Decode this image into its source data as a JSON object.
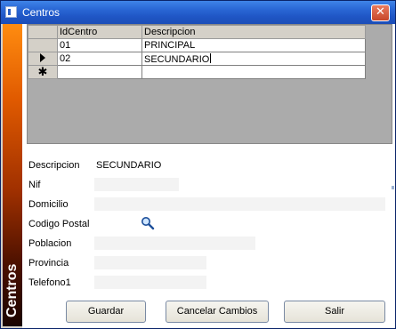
{
  "window": {
    "title": "Centros",
    "close_symbol": "✕",
    "icon": "app-icon",
    "sidebar_label": "Centros"
  },
  "grid": {
    "columns": [
      "IdCentro",
      "Descripcion"
    ],
    "rows": [
      {
        "indicator": "",
        "id": "01",
        "descripcion": "PRINCIPAL"
      },
      {
        "indicator": "current-row-arrow",
        "id": "02",
        "descripcion": "SECUNDARIO"
      }
    ],
    "new_row_symbol": "✱"
  },
  "form": {
    "labels": {
      "descripcion": "Descripcion",
      "nif": "Nif",
      "domicilio": "Domicilio",
      "codigo_postal": "Codigo Postal",
      "poblacion": "Poblacion",
      "provincia": "Provincia",
      "telefono1": "Telefono1"
    },
    "values": {
      "descripcion": "SECUNDARIO",
      "nif": "",
      "domicilio": "",
      "codigo_postal": "",
      "poblacion": "",
      "provincia": "",
      "telefono1": ""
    },
    "lookup_icon": "search-icon"
  },
  "buttons": {
    "guardar": "Guardar",
    "cancelar": "Cancelar Cambios",
    "salir": "Salir"
  },
  "colors": {
    "titlebar": "#2a68d6",
    "sidebar_top": "#ff8c10",
    "sidebar_bottom": "#1a0400",
    "grid_background": "#ababab"
  }
}
